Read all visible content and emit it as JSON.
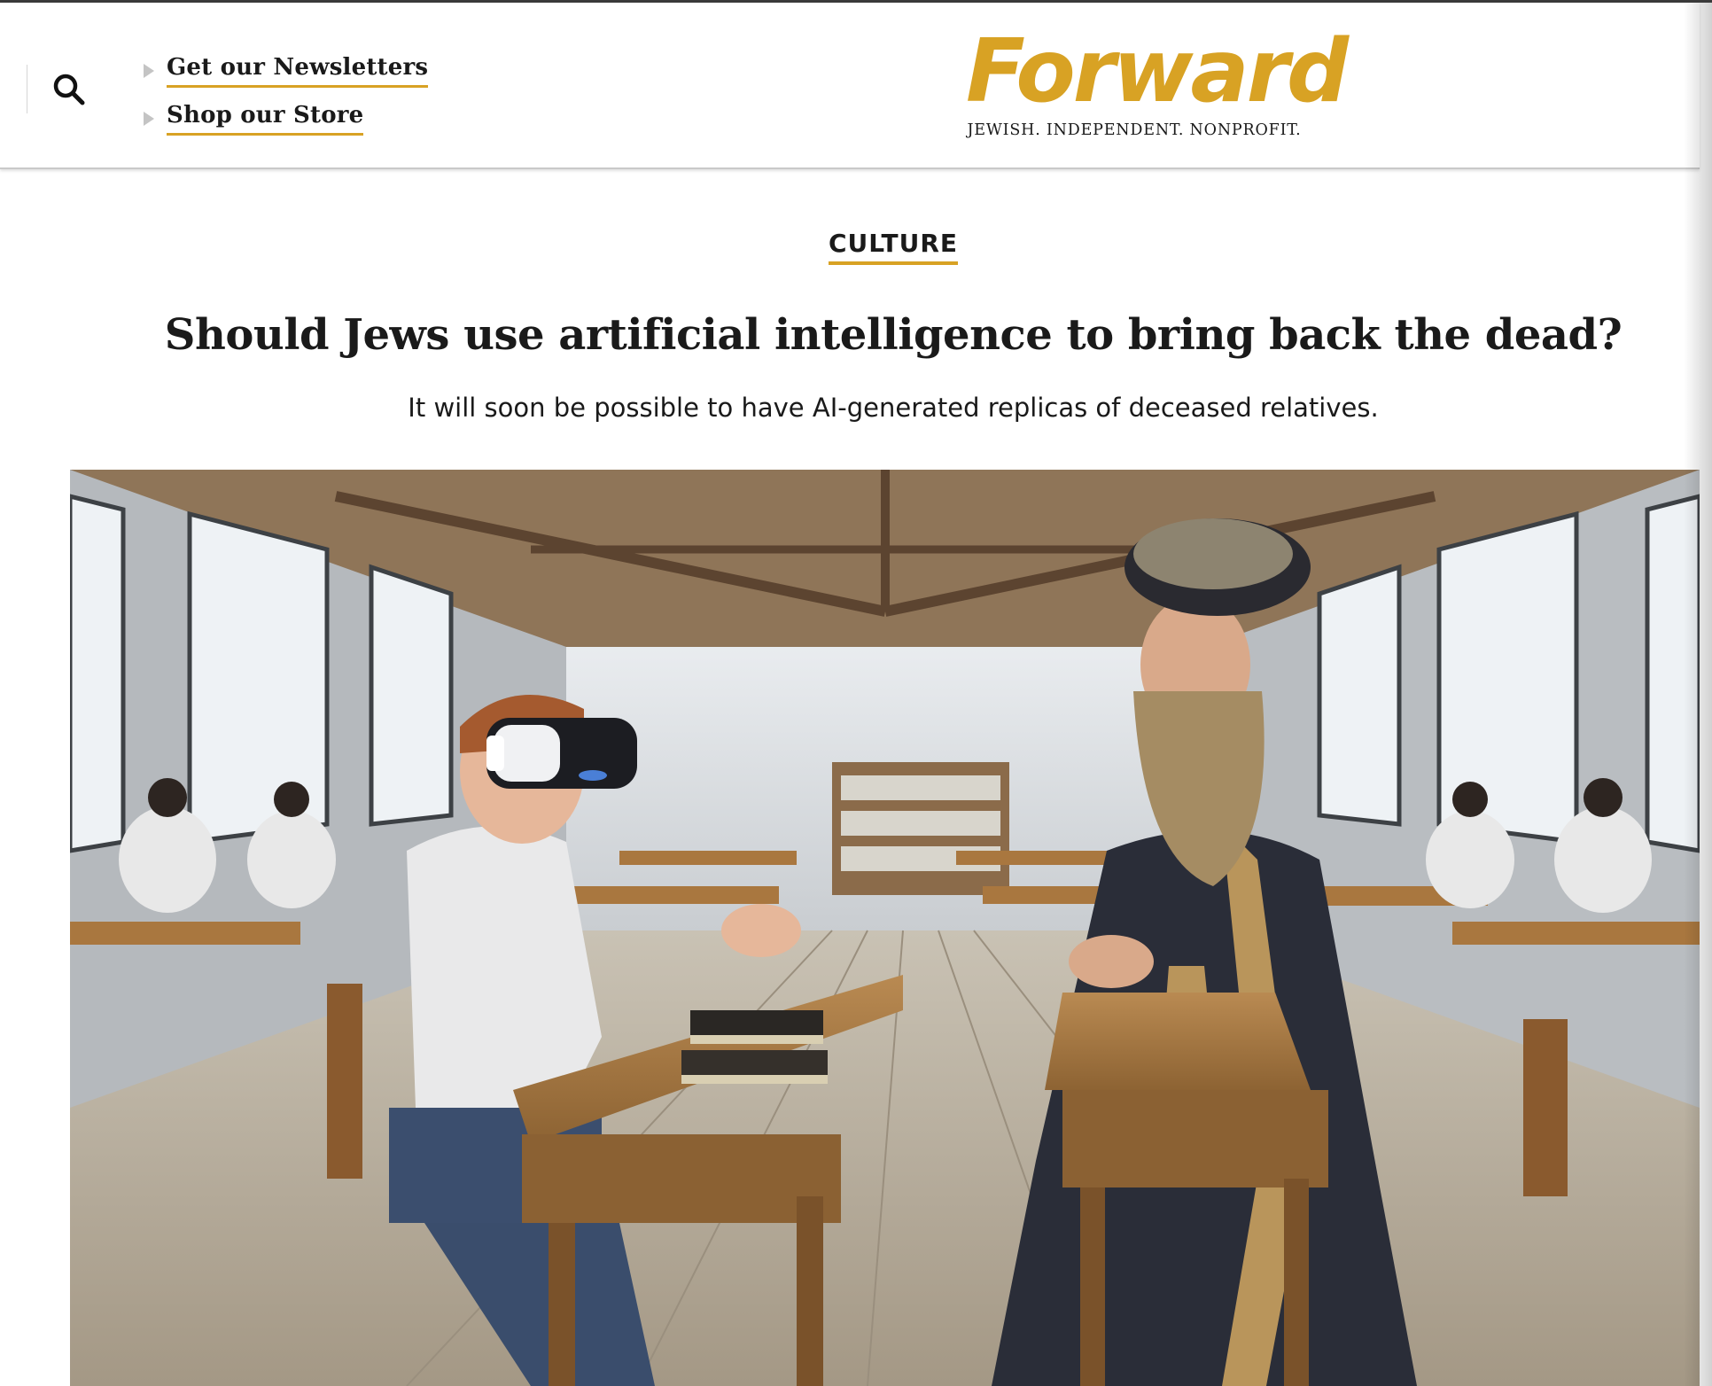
{
  "header": {
    "search_icon": "search-icon",
    "nav_links": [
      {
        "label": "Get our Newsletters"
      },
      {
        "label": "Shop our Store"
      }
    ],
    "logo": {
      "wordmark": "Forward",
      "tagline": "JEWISH. INDEPENDENT. NONPROFIT."
    }
  },
  "article": {
    "section": "CULTURE",
    "headline": "Should Jews use artificial intelligence to bring back the dead?",
    "subheadline": "It will soon be possible to have AI-generated replicas of deceased relatives.",
    "hero_image": "classroom with a young man wearing a VR headset seated across from a bearded rabbi"
  },
  "colors": {
    "brand_gold": "#d8a224",
    "text": "#1a1a1a"
  }
}
